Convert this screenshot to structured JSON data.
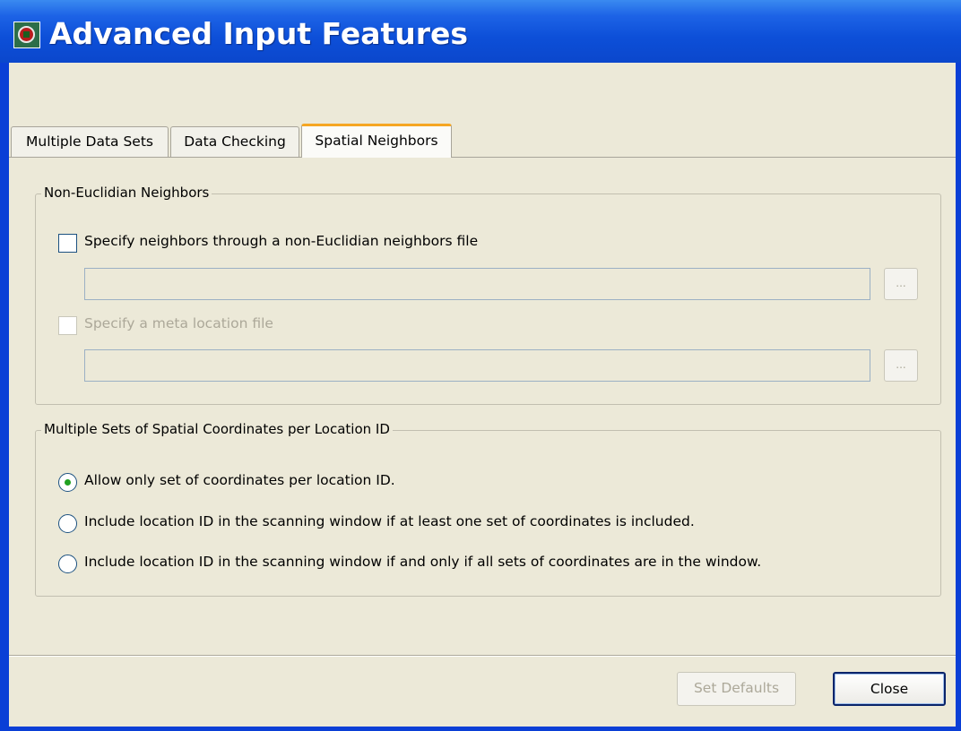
{
  "window": {
    "title": "Advanced Input Features"
  },
  "tabs": [
    {
      "label": "Multiple Data Sets",
      "active": false
    },
    {
      "label": "Data Checking",
      "active": false
    },
    {
      "label": "Spatial Neighbors",
      "active": true
    }
  ],
  "non_euclidian_group": {
    "title": "Non-Euclidian Neighbors",
    "neighbors_file_checkbox": {
      "label": "Specify neighbors through a non-Euclidian neighbors file",
      "checked": false,
      "enabled": true
    },
    "neighbors_file_path": {
      "value": "",
      "enabled": false
    },
    "neighbors_browse_label": "...",
    "meta_location_checkbox": {
      "label": "Specify a meta location file",
      "checked": false,
      "enabled": false
    },
    "meta_location_path": {
      "value": "",
      "enabled": false
    },
    "meta_browse_label": "..."
  },
  "multiple_coords_group": {
    "title": "Multiple Sets of Spatial Coordinates per Location ID",
    "options": [
      {
        "label": "Allow only set of coordinates per location ID.",
        "selected": true
      },
      {
        "label": "Include location ID in the scanning window if at least one set of coordinates is included.",
        "selected": false
      },
      {
        "label": "Include location ID in the scanning window if and only if all sets of coordinates are in the window.",
        "selected": false
      }
    ]
  },
  "footer": {
    "set_defaults_label": "Set Defaults",
    "set_defaults_enabled": false,
    "close_label": "Close"
  },
  "colors": {
    "titlebar": "#0b47cc",
    "dialog_background": "#ece9d8",
    "active_tab_accent": "#f5a623",
    "radio_selected": "#21a121",
    "disabled_text": "#aca899"
  }
}
